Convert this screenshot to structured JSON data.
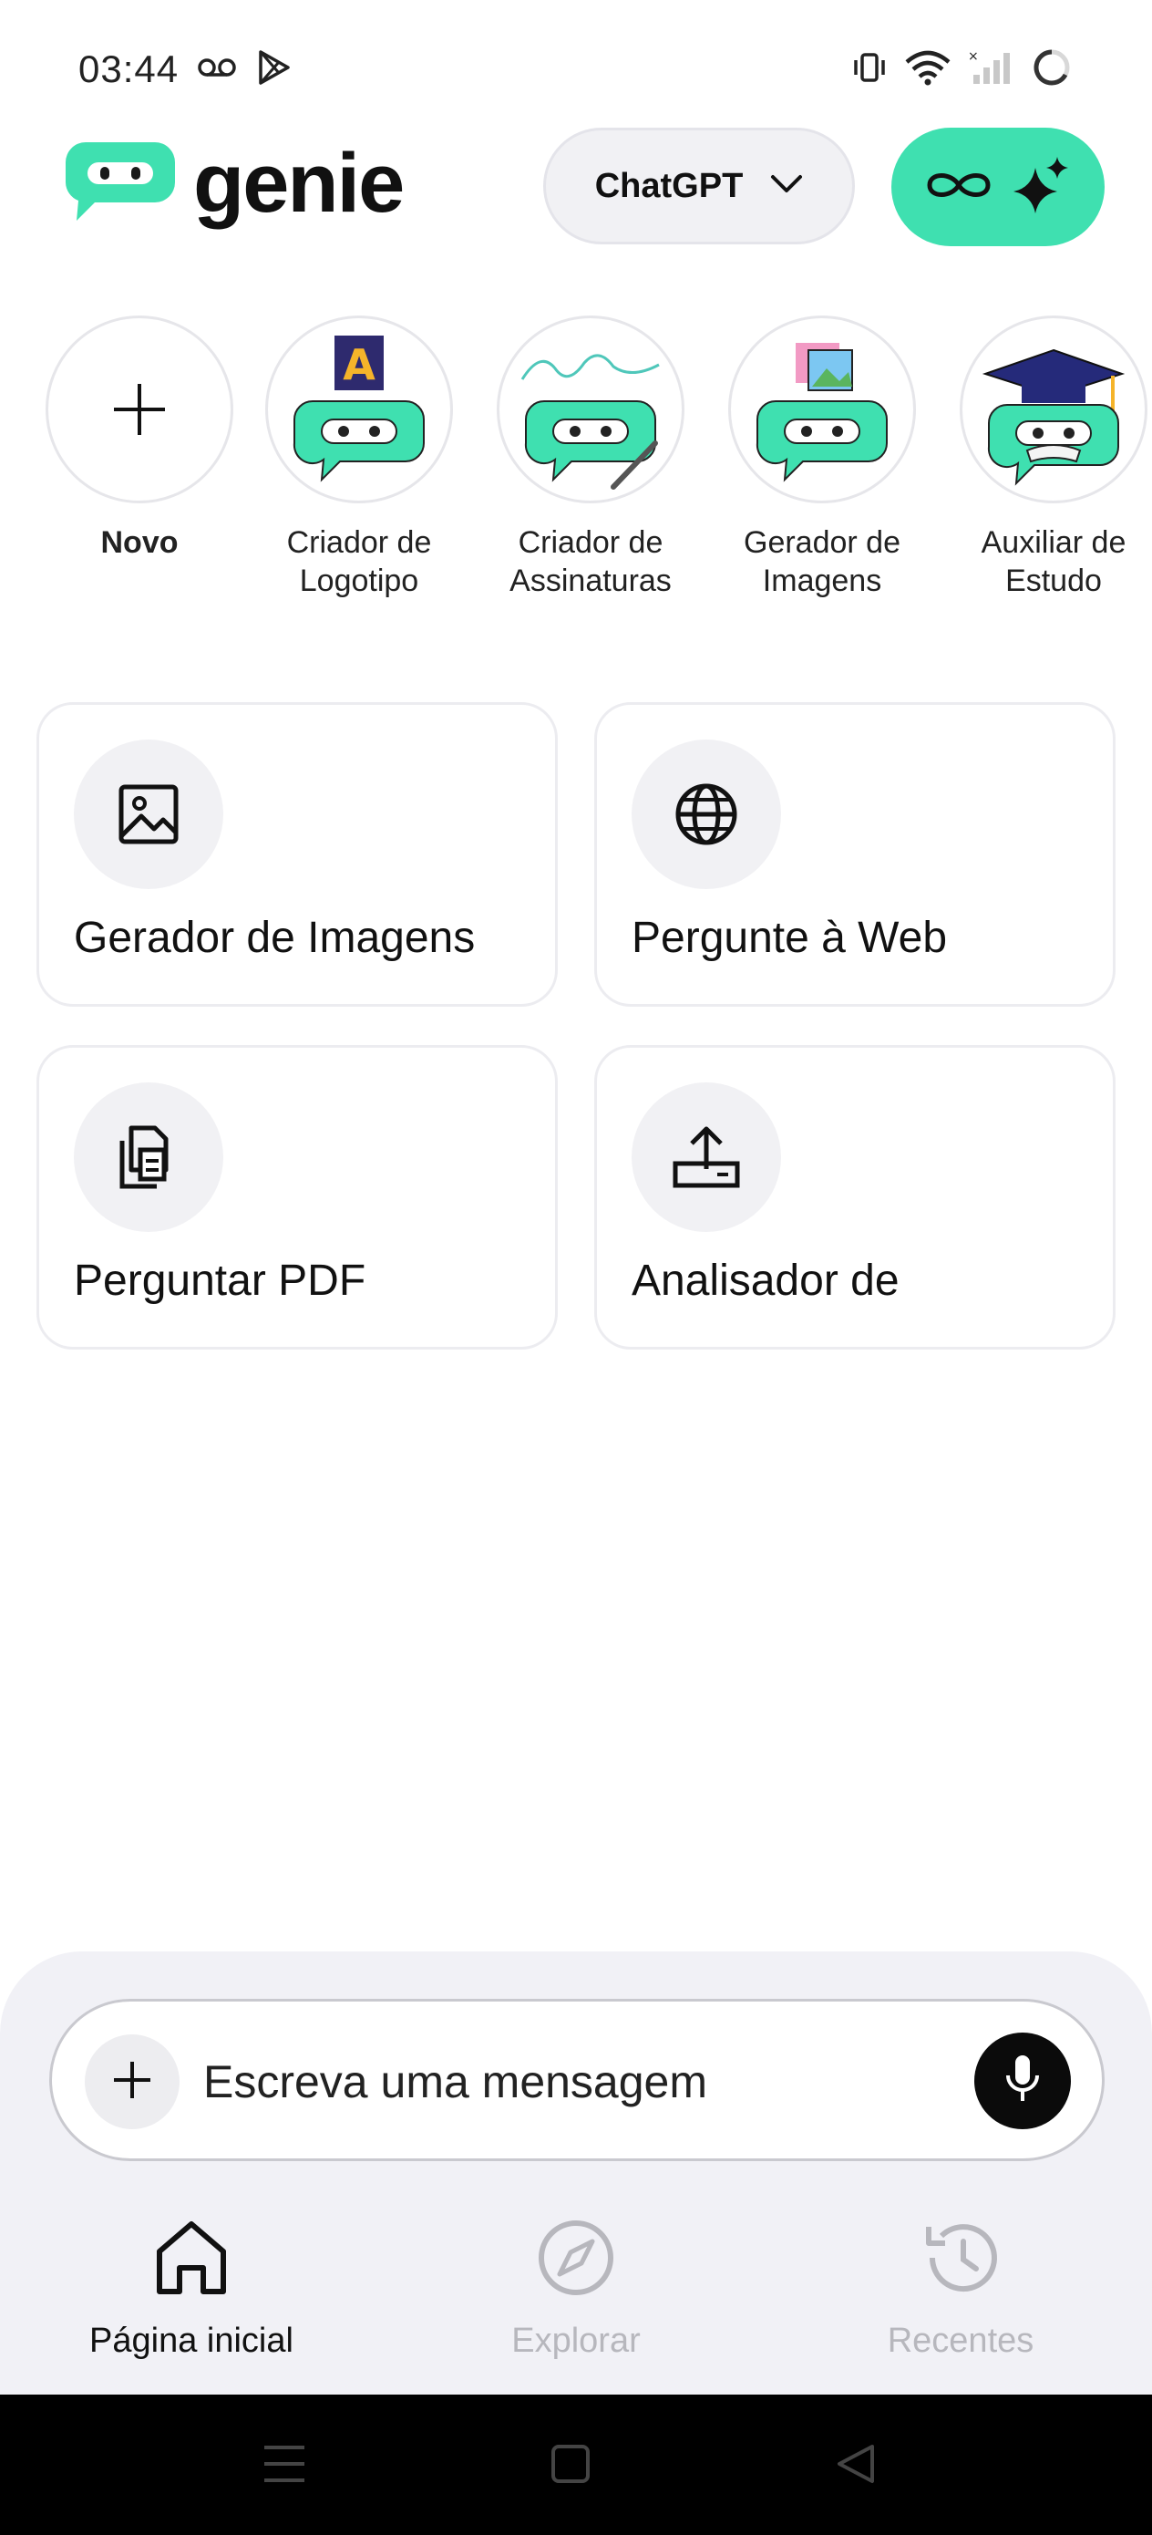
{
  "status_bar": {
    "time": "03:44",
    "left_icons": [
      "voicemail-icon",
      "play-store-icon"
    ],
    "right_icons": [
      "vibrate-icon",
      "wifi-icon",
      "signal-icon",
      "battery-icon"
    ]
  },
  "header": {
    "logo_text": "genie",
    "model_selector": {
      "label": "ChatGPT",
      "icon": "chevron-down-icon"
    },
    "pro_button": {
      "icons": [
        "infinity-icon",
        "sparkle-icon"
      ]
    }
  },
  "quick_actions": [
    {
      "label": "Novo",
      "icon": "plus-icon"
    },
    {
      "label": "Criador de\nLogotipo",
      "icon": "logo-maker-avatar"
    },
    {
      "label": "Criador de\nAssinaturas",
      "icon": "signature-maker-avatar"
    },
    {
      "label": "Gerador de\nImagens",
      "icon": "image-generator-avatar"
    },
    {
      "label": "Auxiliar de\nEstudo",
      "icon": "study-helper-avatar"
    }
  ],
  "feature_cards": [
    {
      "title": "Gerador de Imagens",
      "icon": "image-icon"
    },
    {
      "title": "Pergunte à Web",
      "icon": "globe-icon"
    },
    {
      "title": "Perguntar PDF",
      "icon": "documents-icon"
    },
    {
      "title": "Analisador de",
      "icon": "upload-icon"
    }
  ],
  "composer": {
    "placeholder": "Escreva uma mensagem",
    "plus_icon": "plus-icon",
    "mic_icon": "microphone-icon"
  },
  "tabs": [
    {
      "label": "Página inicial",
      "icon": "home-icon",
      "active": true
    },
    {
      "label": "Explorar",
      "icon": "compass-icon",
      "active": false
    },
    {
      "label": "Recentes",
      "icon": "history-icon",
      "active": false
    }
  ],
  "colors": {
    "brand_green": "#3fe0b0",
    "background": "#ffffff",
    "panel": "#f1f1f6",
    "inactive_tab": "#b7b7bd"
  }
}
